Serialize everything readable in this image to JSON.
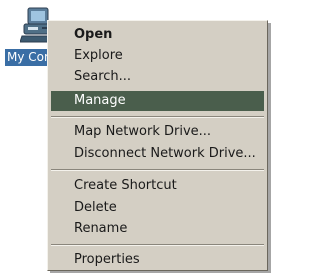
{
  "desktop_icon": {
    "label": "My Computer",
    "icon": "my-computer-icon"
  },
  "context_menu": {
    "items": [
      {
        "label": "Open",
        "bold": true
      },
      {
        "label": "Explore"
      },
      {
        "label": "Search..."
      },
      {
        "label": "Manage",
        "highlighted": true
      },
      {
        "label": "Map Network Drive..."
      },
      {
        "label": "Disconnect Network Drive..."
      },
      {
        "label": "Create Shortcut"
      },
      {
        "label": "Delete"
      },
      {
        "label": "Rename"
      },
      {
        "label": "Properties"
      }
    ]
  },
  "colors": {
    "menu_background": "#d4cfc4",
    "highlight": "#4a5e4c",
    "icon_label_selected": "#3a6ea5"
  }
}
